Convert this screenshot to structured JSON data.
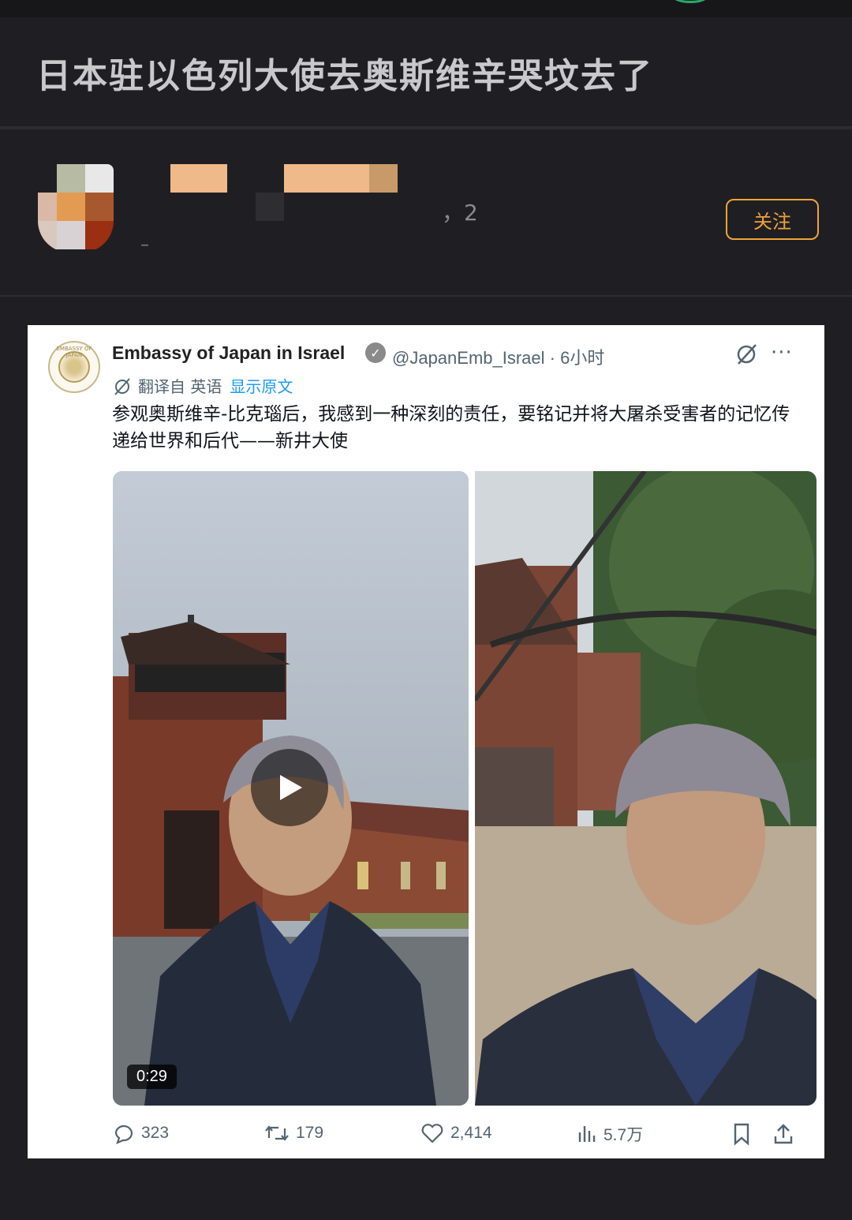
{
  "post": {
    "title": "日本驻以色列大使去奥斯维辛哭坟去了"
  },
  "author": {
    "post_count_fragment": "，2",
    "sub_mark": "–",
    "follow_label": "关注"
  },
  "tweet": {
    "account_name": "Embassy of Japan in Israel",
    "handle_time": "@JapanEmb_Israel · 6小时",
    "logo_text": "EMBASSY OF JAPAN",
    "translated_from": "翻译自 英语",
    "show_original": "显示原文",
    "text": "参观奥斯维辛-比克瑙后，我感到一种深刻的责任，要铭记并将大屠杀受害者的记忆传递给世界和后代——新井大使",
    "video_duration": "0:29",
    "replies": "323",
    "retweets": "179",
    "likes": "2,414",
    "views": "5.7万"
  },
  "colors": {
    "background": "#1f1f23",
    "accent_follow": "#f0a23a",
    "link_blue": "#1d9bf0"
  },
  "icons": [
    "verified-badge-icon",
    "grok-icon",
    "more-icon",
    "translate-icon",
    "play-icon",
    "reply-icon",
    "retweet-icon",
    "like-icon",
    "views-icon",
    "bookmark-icon",
    "share-icon"
  ]
}
